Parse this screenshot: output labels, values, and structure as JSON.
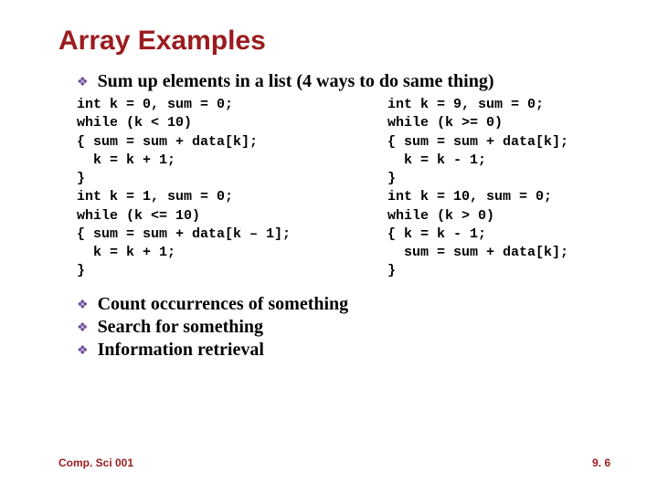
{
  "title": "Array Examples",
  "bullets": {
    "main": "Sum up elements in a list (4 ways to do same thing)",
    "b1": "Count occurrences of something",
    "b2": "Search for something",
    "b3": "Information retrieval"
  },
  "code": {
    "left": "int k = 0, sum = 0;\nwhile (k < 10)\n{ sum = sum + data[k];\n  k = k + 1;\n}\nint k = 1, sum = 0;\nwhile (k <= 10)\n{ sum = sum + data[k – 1];\n  k = k + 1;\n}",
    "right": "int k = 9, sum = 0;\nwhile (k >= 0)\n{ sum = sum + data[k];\n  k = k - 1;\n}\nint k = 10, sum = 0;\nwhile (k > 0)\n{ k = k - 1;\n  sum = sum + data[k];\n}"
  },
  "footer": {
    "left": "Comp. Sci 001",
    "right": "9. 6"
  },
  "glyph": {
    "diamond": "❖"
  }
}
